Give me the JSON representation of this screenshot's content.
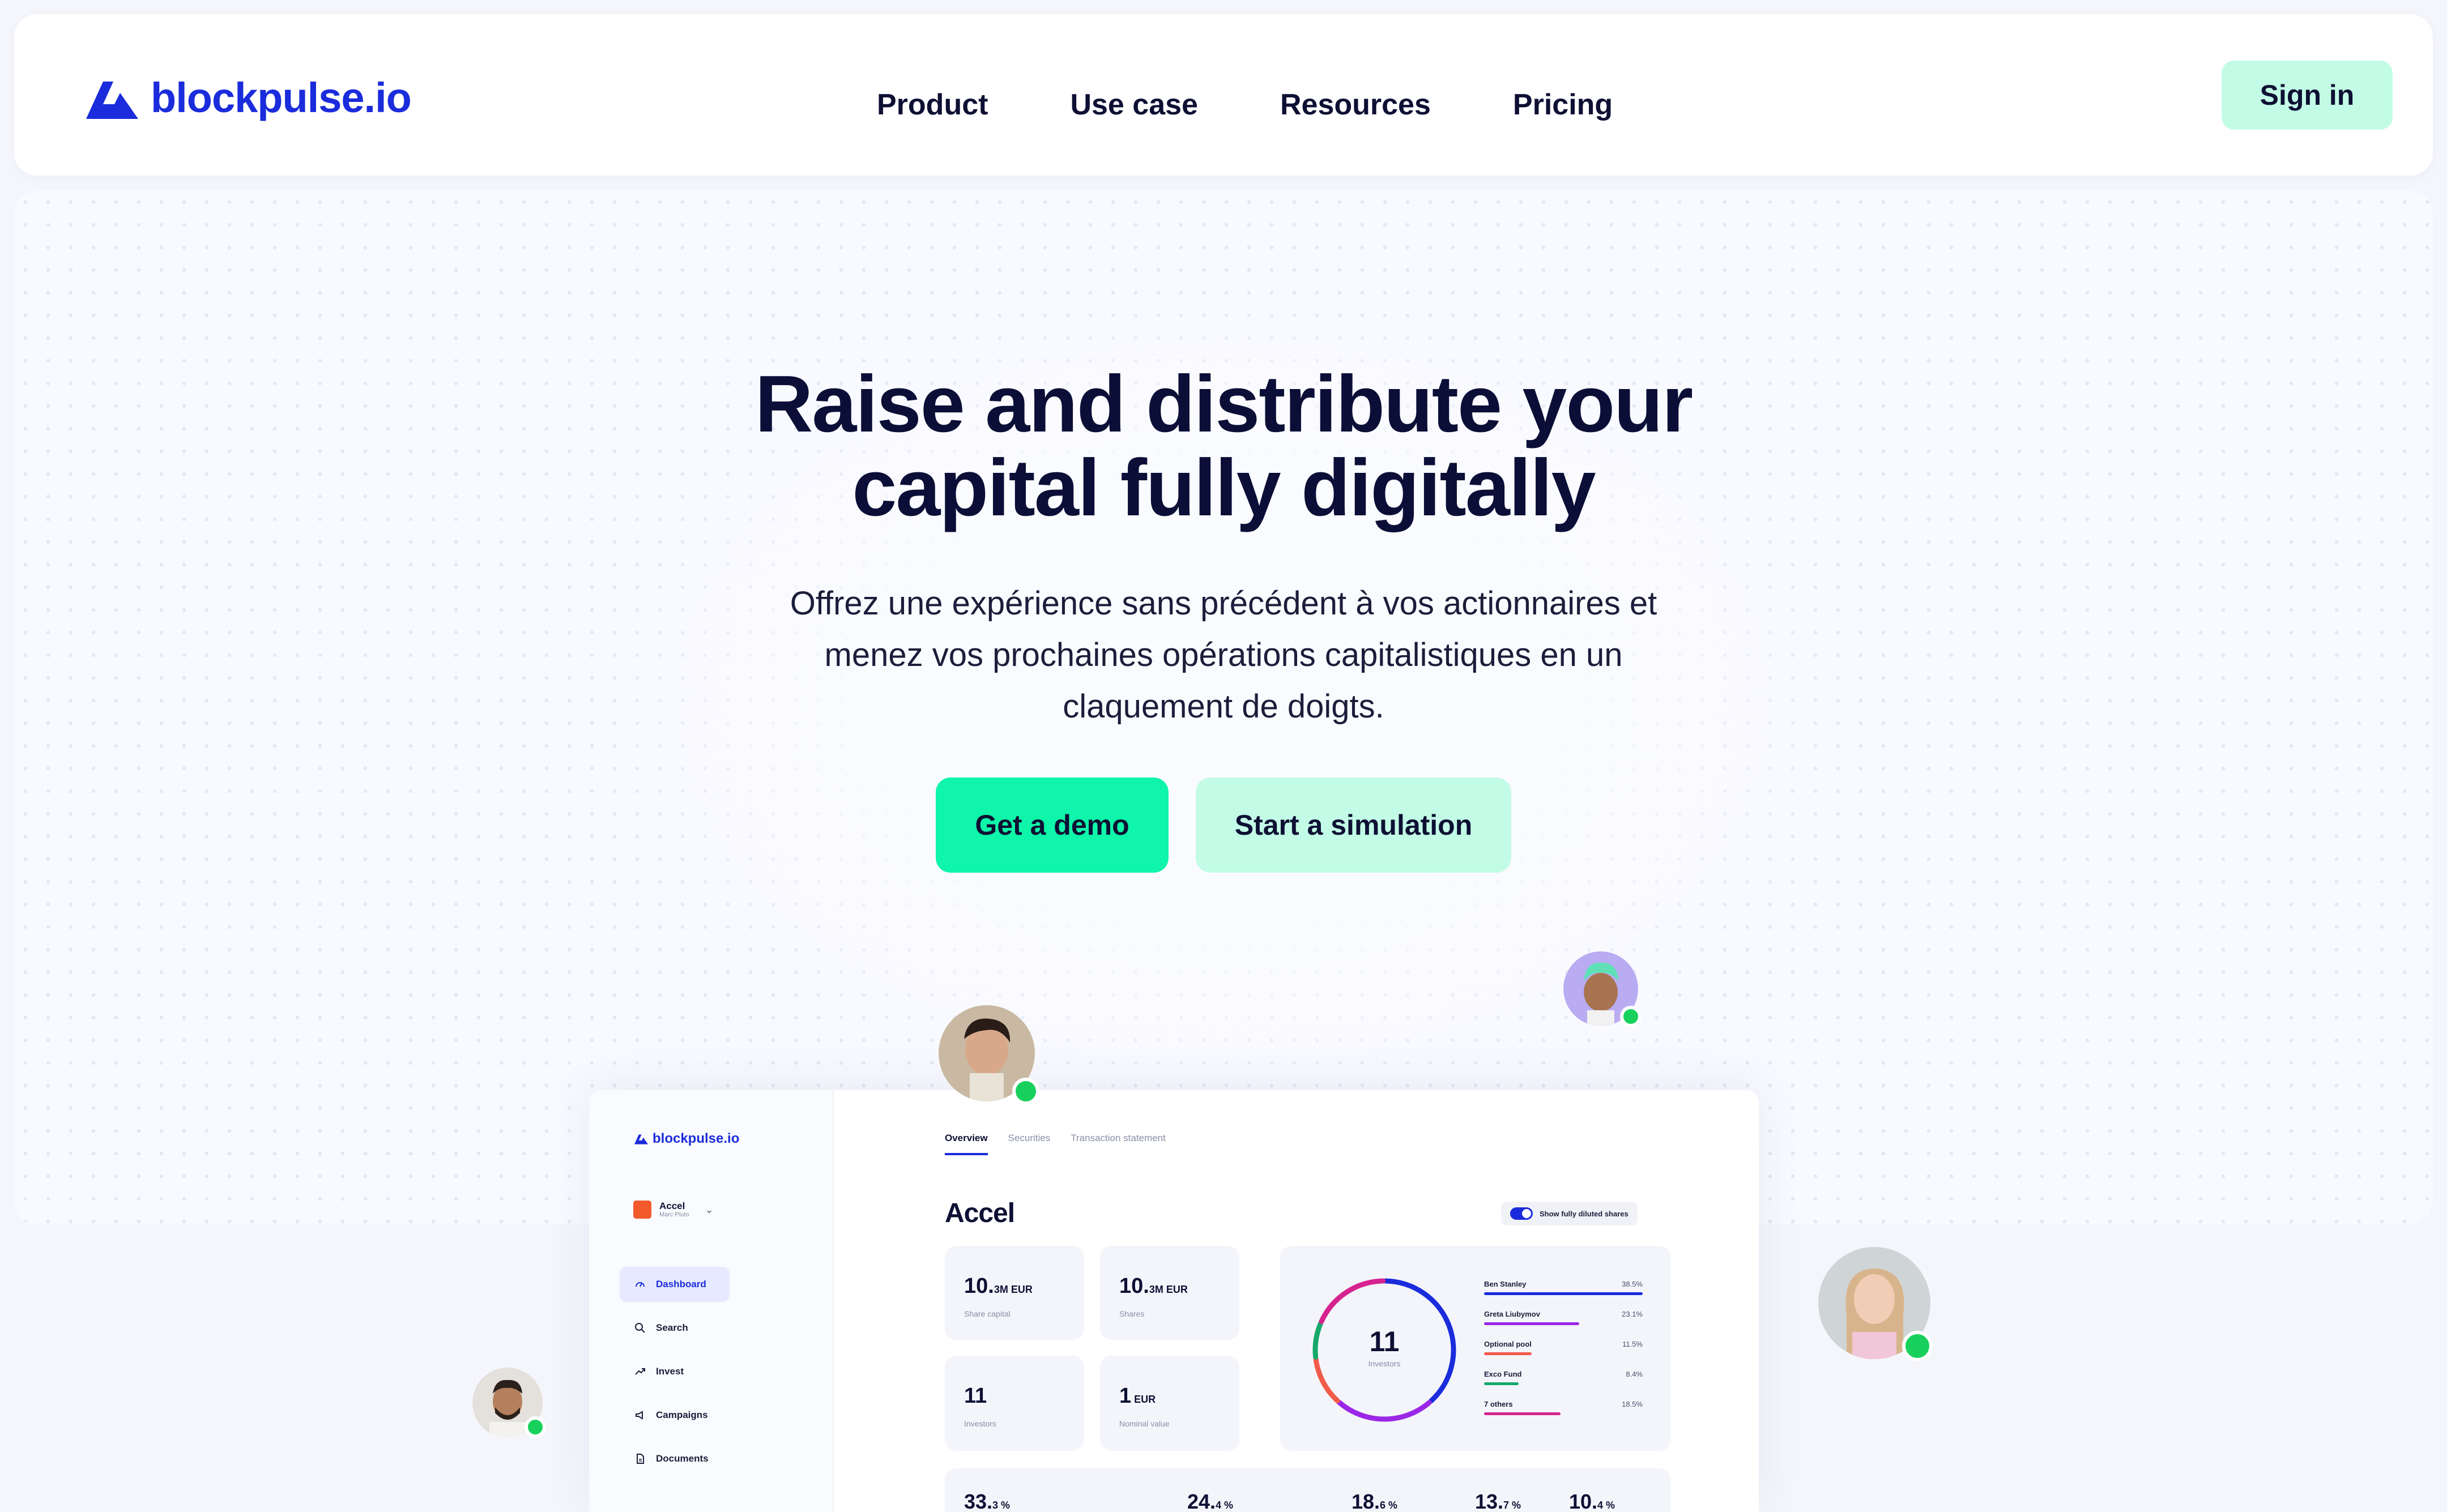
{
  "brand": {
    "name": "blockpulse.io",
    "color": "#1a2cdb",
    "accent": "#0ff5a9",
    "accent_light": "#c3fce6"
  },
  "nav": {
    "links": [
      "Product",
      "Use case",
      "Resources",
      "Pricing"
    ],
    "signin_label": "Sign in"
  },
  "hero": {
    "headline_line1": "Raise and distribute your",
    "headline_line2": "capital fully digitally",
    "subtitle": "Offrez une expérience sans précédent à vos actionnaires et menez vos prochaines opérations capitalistiques en un claquement de doigts.",
    "cta_primary": "Get a demo",
    "cta_secondary": "Start a simulation"
  },
  "app": {
    "logo": "blockpulse.io",
    "company": {
      "name": "Accel",
      "sub": "Marc Pluto"
    },
    "sidebar": [
      {
        "label": "Dashboard",
        "icon": "gauge-icon",
        "active": true
      },
      {
        "label": "Search",
        "icon": "search-icon",
        "active": false
      },
      {
        "label": "Invest",
        "icon": "trending-up-icon",
        "active": false
      },
      {
        "label": "Campaigns",
        "icon": "megaphone-icon",
        "active": false
      },
      {
        "label": "Documents",
        "icon": "document-icon",
        "active": false
      }
    ],
    "tabs": [
      "Overview",
      "Securities",
      "Transaction statement"
    ],
    "title": "Accel",
    "toggle_label": "Show fully diluted shares",
    "stats": [
      {
        "value": "10.",
        "value_small": "3M EUR",
        "label": "Share capital"
      },
      {
        "value": "10.",
        "value_small": "3M EUR",
        "label": "Shares"
      },
      {
        "value": "11",
        "value_small": "",
        "label": "Investors"
      },
      {
        "value": "1",
        "value_small": " EUR",
        "label": "Nominal value"
      }
    ],
    "investors": {
      "count": "11",
      "label": "Investors",
      "legend": [
        {
          "name": "Ben Stanley",
          "pct": "38.5%",
          "value": 38.5,
          "color": "#1a2cdb"
        },
        {
          "name": "Greta Liubymov",
          "pct": "23.1%",
          "value": 23.1,
          "color": "#9b27e6"
        },
        {
          "name": "Optional pool",
          "pct": "11.5%",
          "value": 11.5,
          "color": "#f25a4a"
        },
        {
          "name": "Exco Fund",
          "pct": "8.4%",
          "value": 8.4,
          "color": "#17a86a"
        },
        {
          "name": "7 others",
          "pct": "18.5%",
          "value": 18.5,
          "color": "#d6238f"
        }
      ]
    },
    "bottom_pcts": [
      {
        "value": "33.",
        "small": "3 %"
      },
      {
        "value": "24.",
        "small": "4 %"
      },
      {
        "value": "18.",
        "small": "6 %"
      },
      {
        "value": "13.",
        "small": "7 %"
      },
      {
        "value": "10.",
        "small": "4 %"
      }
    ]
  }
}
